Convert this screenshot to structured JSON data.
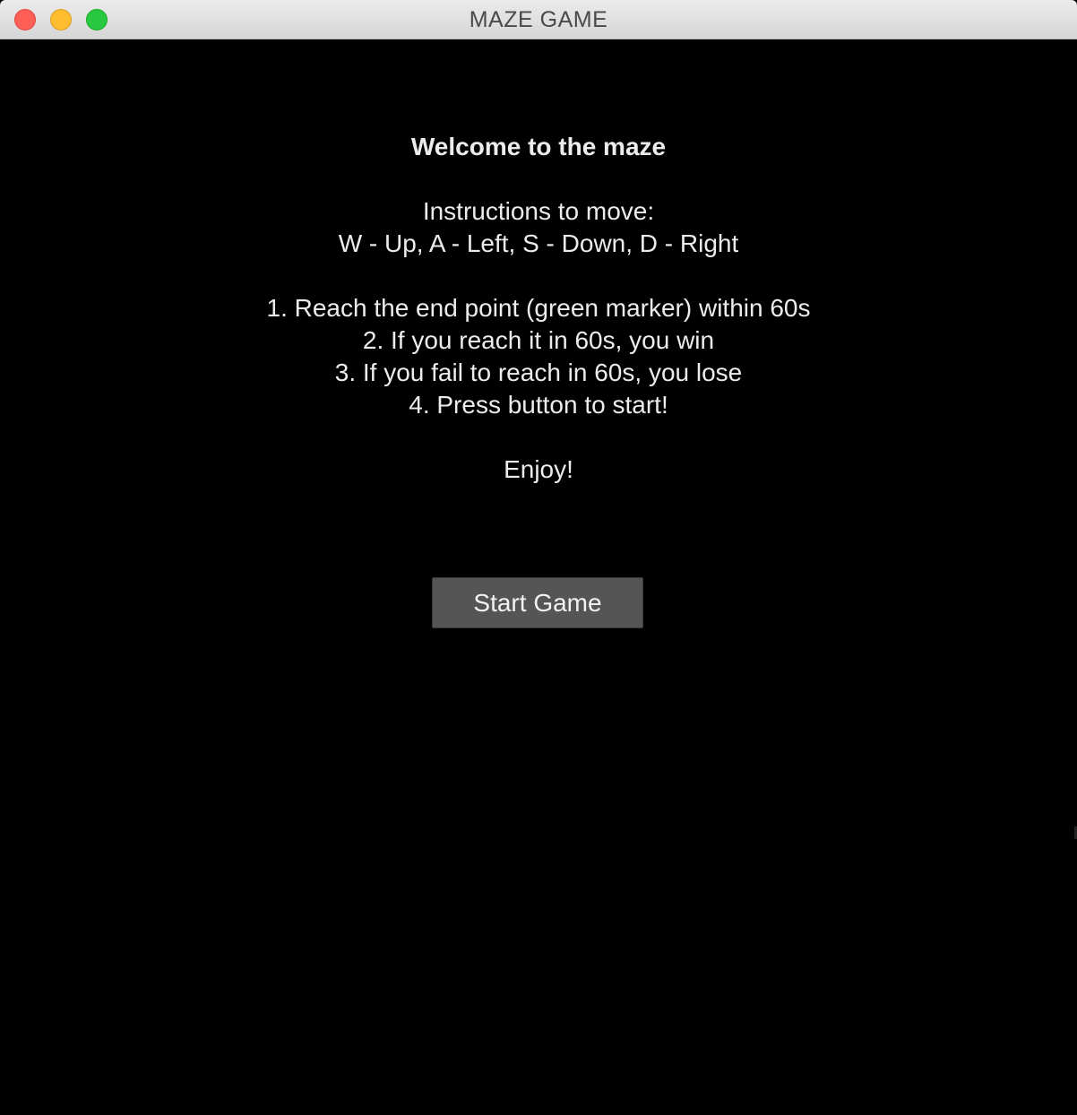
{
  "window": {
    "title": "MAZE GAME"
  },
  "intro": {
    "welcome": "Welcome to the maze",
    "instructions_heading": "Instructions to move:",
    "controls": "W - Up, A - Left, S - Down, D - Right",
    "rules": [
      "1. Reach the end point (green marker) within 60s",
      "2. If you reach it in 60s, you win",
      "3. If you fail to reach in 60s, you lose",
      "4. Press button to start!"
    ],
    "closing": "Enjoy!"
  },
  "start_button": {
    "label": "Start Game"
  },
  "colors": {
    "background": "#000000",
    "text": "#ececec",
    "button_bg": "#555555",
    "close": "#fe5f57",
    "minimize": "#febc2e",
    "zoom": "#28c840"
  },
  "icons": [
    "close-icon",
    "minimize-icon",
    "zoom-icon"
  ]
}
